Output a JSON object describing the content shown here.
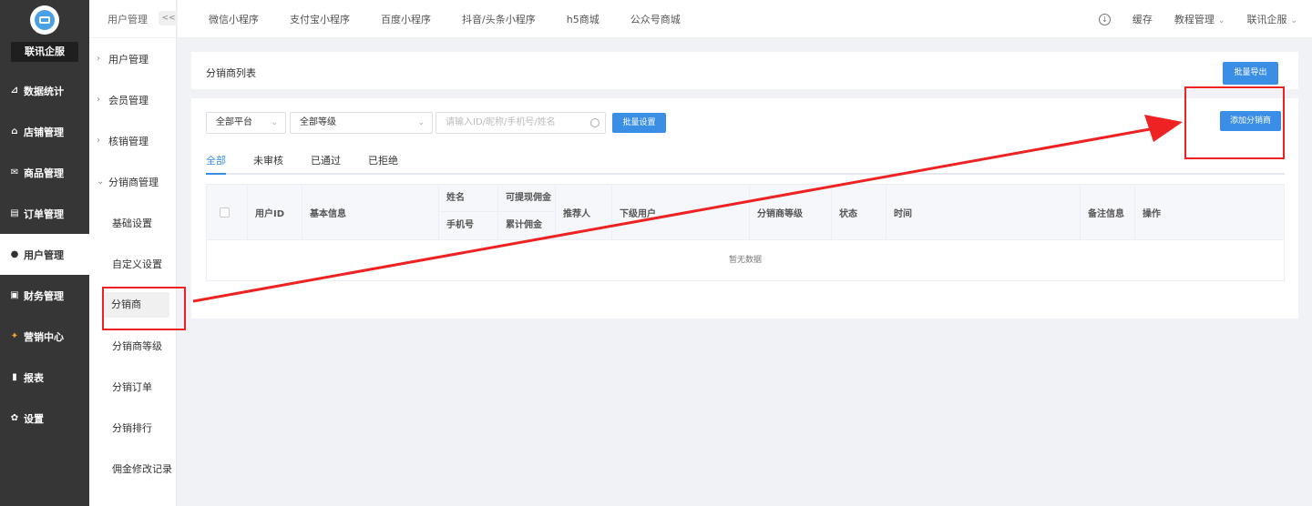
{
  "brand": "联讯企服",
  "nav": [
    {
      "label": "数据统计",
      "icon": "line-chart-icon"
    },
    {
      "label": "店铺管理",
      "icon": "store-icon"
    },
    {
      "label": "商品管理",
      "icon": "mail-icon"
    },
    {
      "label": "订单管理",
      "icon": "order-icon"
    },
    {
      "label": "用户管理",
      "icon": "user-icon",
      "active": true
    },
    {
      "label": "财务管理",
      "icon": "wallet-icon"
    },
    {
      "label": "营销中心",
      "icon": "marketing-icon"
    },
    {
      "label": "报表",
      "icon": "bar-chart-icon"
    },
    {
      "label": "设置",
      "icon": "gear-icon"
    }
  ],
  "subnav": {
    "header": "用户管理",
    "collapse": "<<",
    "groups": [
      "用户管理",
      "会员管理",
      "核销管理",
      "分销商管理"
    ],
    "items": [
      "基础设置",
      "自定义设置",
      "分销商",
      "分销商等级",
      "分销订单",
      "分销排行",
      "佣金修改记录"
    ]
  },
  "topbar": {
    "tabs": [
      "微信小程序",
      "支付宝小程序",
      "百度小程序",
      "抖音/头条小程序",
      "h5商城",
      "公众号商城"
    ],
    "cache": "缓存",
    "tutorial": "教程管理",
    "account": "联讯企服"
  },
  "page": {
    "title": "分销商列表",
    "export_label": "批量导出",
    "platform": "全部平台",
    "level": "全部等级",
    "search_placeholder": "请输入ID/昵称/手机号/姓名",
    "batch_label": "批量设置",
    "add_label": "添加分销商",
    "tabs": [
      "全部",
      "未审核",
      "已通过",
      "已拒绝"
    ],
    "columns": {
      "user_id": "用户ID",
      "basic": "基本信息",
      "name": "姓名",
      "phone": "手机号",
      "withdrawable": "可提现佣金",
      "total": "累计佣金",
      "referrer": "推荐人",
      "sub_users": "下级用户",
      "level": "分销商等级",
      "status": "状态",
      "time": "时间",
      "remark": "备注信息",
      "actions": "操作"
    },
    "empty": "暂无数据"
  },
  "colors": {
    "primary": "#3a8ee6",
    "sidebar": "#363636",
    "annotation": "#ee2222"
  }
}
